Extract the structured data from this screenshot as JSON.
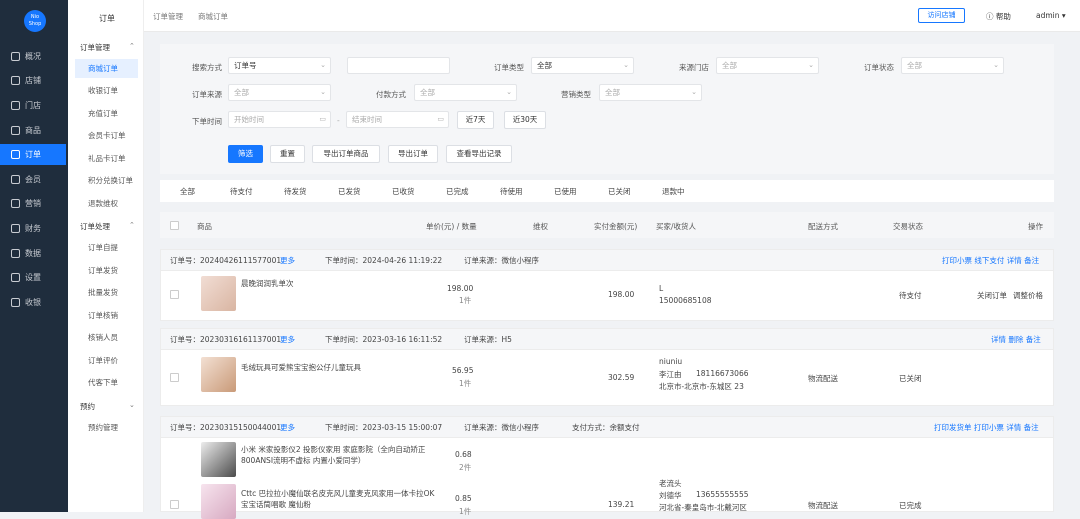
{
  "sidebar": {
    "logo_line1": "Nio",
    "logo_line2": "Shop",
    "items": [
      {
        "label": "概况"
      },
      {
        "label": "店铺"
      },
      {
        "label": "门店"
      },
      {
        "label": "商品"
      },
      {
        "label": "订单"
      },
      {
        "label": "会员"
      },
      {
        "label": "营销"
      },
      {
        "label": "财务"
      },
      {
        "label": "数据"
      },
      {
        "label": "设置"
      },
      {
        "label": "收银"
      }
    ]
  },
  "submenu": {
    "title": "订单",
    "group1": "订单管理",
    "group1_items": [
      "商城订单",
      "收银订单",
      "充值订单",
      "会员卡订单",
      "礼品卡订单",
      "积分兑换订单",
      "退款维权"
    ],
    "group2": "订单处理",
    "group2_items": [
      "订单自提",
      "订单发货",
      "批量发货",
      "订单核销",
      "核销人员",
      "订单评价",
      "代客下单"
    ],
    "group3": "预约",
    "group3_items": [
      "预约管理"
    ]
  },
  "topbar": {
    "breadcrumb1": "订单管理",
    "breadcrumb2": "商城订单",
    "visit_store": "访问店铺",
    "help": "帮助",
    "user": "admin"
  },
  "filters": {
    "search_label": "搜索方式",
    "search_value": "订单号",
    "order_type_label": "订单类型",
    "order_type_value": "全部",
    "store_label": "来源门店",
    "store_value": "全部",
    "status_label": "订单状态",
    "status_value": "全部",
    "source_label": "订单来源",
    "source_value": "全部",
    "pay_label": "付款方式",
    "pay_value": "全部",
    "marketing_label": "营销类型",
    "marketing_value": "全部",
    "time_label": "下单时间",
    "start_ph": "开始时间",
    "end_ph": "结束时间",
    "btn7": "近7天",
    "btn30": "近30天",
    "filter_btn": "筛选",
    "reset_btn": "重置",
    "export_goods_btn": "导出订单商品",
    "export_order_btn": "导出订单",
    "export_record_btn": "查看导出记录"
  },
  "tabs": [
    "全部",
    "待支付",
    "待发货",
    "已发货",
    "已收货",
    "已完成",
    "待使用",
    "已使用",
    "已关闭",
    "退款中"
  ],
  "table_head": {
    "goods": "商品",
    "price_qty": "单价(元) / 数量",
    "rights": "维权",
    "paid": "实付金额(元)",
    "buyer": "买家/收货人",
    "delivery": "配送方式",
    "status": "交易状态",
    "ops": "操作"
  },
  "orders": [
    {
      "no": "订单号：20240426111577001",
      "more": "更多",
      "time": "下单时间：2024-04-26 11:19:22",
      "source": "订单来源：微信小程序",
      "actions": "打印小票 线下支付 详情 备注",
      "item_name": "晨晚润润乳单次",
      "price": "198.00",
      "qty": "1件",
      "paid": "198.00",
      "buyer1": "L",
      "buyer2": "15000685108",
      "status": "待支付",
      "op1": "关闭订单",
      "op2": "调整价格"
    },
    {
      "no": "订单号：20230316161137001",
      "more": "更多",
      "time": "下单时间：2023-03-16 16:11:52",
      "source": "订单来源：H5",
      "actions": "详情 删除 备注",
      "item_name": "毛绒玩具可爱熊宝宝抱公仔儿童玩具",
      "price": "56.95",
      "qty": "1件",
      "paid": "302.59",
      "buyer_nick": "niuniu",
      "buyer1": "李江由",
      "buyer_phone": "18116673066",
      "buyer2": "北京市-北京市-东城区 23",
      "status": "已关闭",
      "delivery": "物流配送"
    },
    {
      "no": "订单号：20230315150044001",
      "more": "更多",
      "time": "下单时间：2023-03-15 15:00:07",
      "source": "订单来源：微信小程序",
      "paytype": "支付方式：余额支付",
      "actions": "打印发货单 打印小票 详情 备注",
      "item_name": "小米 米家投影仪2 投影仪家用 家庭影院（全向自动矫正 800ANSI流明不虚标 内置小爱同学）",
      "price": "0.68",
      "qty": "2件",
      "item2_name": "Cttc 巴拉拉小魔仙联名皮克风儿童麦克风家用一体卡拉OK宝宝话筒唱歌 魔仙粉",
      "price2": "0.85",
      "qty2": "1件",
      "paid": "139.21",
      "buyer_nick": "老流头",
      "buyer1": "刘德华",
      "buyer_phone": "13655555555",
      "buyer2": "河北省-秦皇岛市-北戴河区",
      "delivery": "物流配送",
      "status": "已完成"
    }
  ]
}
